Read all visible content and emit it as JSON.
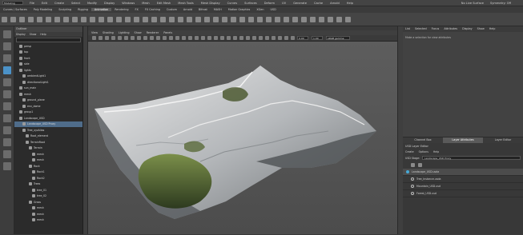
{
  "menubar": {
    "workspace": "Modeling",
    "items": [
      "File",
      "Edit",
      "Create",
      "Select",
      "Modify",
      "Display",
      "Windows",
      "Mesh",
      "Edit Mesh",
      "Mesh Tools",
      "Mesh Display",
      "Curves",
      "Surfaces",
      "Deform",
      "UV",
      "Generate",
      "Cache",
      "Arnold",
      "Help"
    ],
    "live_surface": "No Live Surface",
    "symmetry": "Symmetry: Off"
  },
  "shelf_tabs": {
    "items": [
      "Curves / Surfaces",
      "Poly Modeling",
      "Sculpting",
      "Rigging",
      "Animation",
      "Rendering",
      "FX",
      "FX Caching",
      "Custom",
      "Arnold",
      "Bifrost",
      "MASH",
      "Motion Graphics",
      "XGen",
      "USD"
    ],
    "active_index": 4
  },
  "outliner": {
    "title": "Outliner",
    "menu": [
      "Display",
      "Show",
      "Help"
    ],
    "items": [
      {
        "label": "persp",
        "indent": 1
      },
      {
        "label": "top",
        "indent": 1
      },
      {
        "label": "front",
        "indent": 1
      },
      {
        "label": "side",
        "indent": 1
      },
      {
        "label": "lights",
        "indent": 1
      },
      {
        "label": "ambientLight1",
        "indent": 2
      },
      {
        "label": "directionalLight1",
        "indent": 2
      },
      {
        "label": "sun_main",
        "indent": 1
      },
      {
        "label": "mesh",
        "indent": 1
      },
      {
        "label": "ground_plane",
        "indent": 2
      },
      {
        "label": "env_dome",
        "indent": 2
      },
      {
        "label": "group1",
        "indent": 1
      },
      {
        "label": "Landscape_USD",
        "indent": 1
      },
      {
        "label": "Landscape_USD Proxy",
        "indent": 2
      },
      {
        "label": "Tree_xyzAlias",
        "indent": 2
      },
      {
        "label": "Root_element",
        "indent": 3
      },
      {
        "label": "TerrainRoot",
        "indent": 3
      },
      {
        "label": "Terrain",
        "indent": 4
      },
      {
        "label": "mesh",
        "indent": 5
      },
      {
        "label": "mesh",
        "indent": 5
      },
      {
        "label": "Rock",
        "indent": 4
      },
      {
        "label": "Rock1",
        "indent": 5
      },
      {
        "label": "Rock2",
        "indent": 5
      },
      {
        "label": "Trees",
        "indent": 4
      },
      {
        "label": "tree_01",
        "indent": 5
      },
      {
        "label": "tree_02",
        "indent": 5
      },
      {
        "label": "Grass",
        "indent": 4
      },
      {
        "label": "mesh",
        "indent": 5
      },
      {
        "label": "mesh",
        "indent": 5
      },
      {
        "label": "mesh",
        "indent": 5
      }
    ],
    "selected_index": 13
  },
  "viewport": {
    "menu": [
      "View",
      "Shading",
      "Lighting",
      "Show",
      "Renderer",
      "Panels"
    ],
    "field_a": "0.00",
    "field_b": "1.00",
    "colorspace": "sRGB gamma"
  },
  "attribute_editor": {
    "tabs": [
      "List",
      "Selected",
      "Focus",
      "Attributes",
      "Display",
      "Show",
      "Help"
    ],
    "message": "Make a selection for view attributes"
  },
  "layer_editor": {
    "tabs": [
      "Channel Box",
      "Layer Attributes",
      "Layer Editor"
    ],
    "active_tab": 1,
    "title": "USD Layer Editor",
    "menu": [
      "Create",
      "Options",
      "Help"
    ],
    "stage_label": "USD Stage:",
    "stage_value": "Landscape_USD Proxy",
    "root_layer": "Landscape_USD.usda",
    "layers": [
      "Tree_Instance.usda",
      "Mountain_USD.usd",
      "Forest_USD.usd"
    ]
  },
  "colors": {
    "accent": "#4b92c8",
    "selection": "#4f6c8a",
    "usd_dot": "#46a9d6"
  }
}
